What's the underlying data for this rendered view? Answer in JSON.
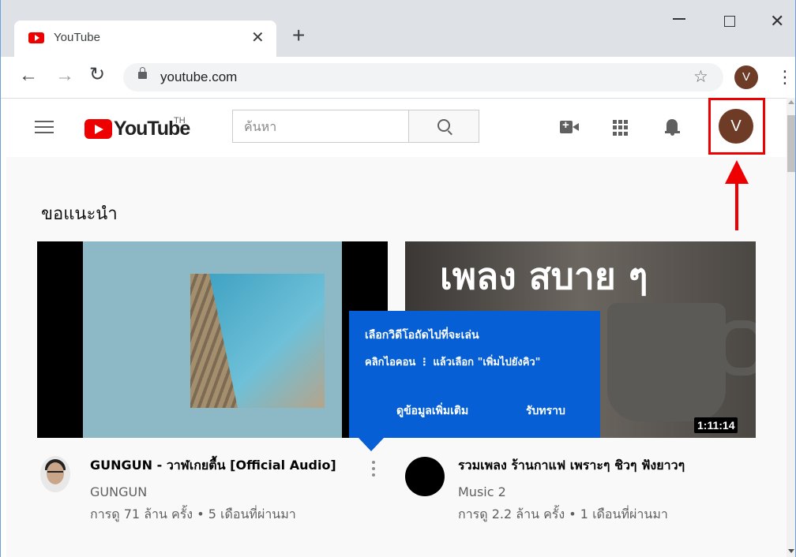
{
  "browser": {
    "tab_title": "YouTube",
    "tab_close": "✕",
    "new_tab": "+",
    "url": "youtube.com",
    "profile_initial": "V",
    "star": "☆",
    "kebab": "⋮",
    "back": "←",
    "forward": "→",
    "reload": "↻",
    "window_close": "✕"
  },
  "youtube": {
    "logo_text": "YouTube",
    "logo_region": "TH",
    "search_placeholder": "ค้นหา",
    "avatar_initial": "V",
    "section_title": "ขอแนะนำ"
  },
  "tooltip": {
    "title": "เลือกวิดีโอถัดไปที่จะเล่น",
    "body": "คลิกไอคอน ⋮ แล้วเลือก \"เพิ่มไปยังคิว\"",
    "more_button": "ดูข้อมูลเพิ่มเติม",
    "ok_button": "รับทราบ"
  },
  "videos": [
    {
      "title": "GUNGUN - วาฬเกยตื้น [Official Audio]",
      "channel": "GUNGUN",
      "meta": "การดู 71 ล้าน ครั้ง • 5 เดือนที่ผ่านมา"
    },
    {
      "title": "รวมเพลง ร้านกาแฟ เพราะๆ ชิวๆ ฟังยาวๆ",
      "channel": "Music 2",
      "meta": "การดู 2.2 ล้าน ครั้ง • 1 เดือนที่ผ่านมา",
      "thumb_text": "เพลง สบาย ๆ",
      "duration": "1:11:14"
    }
  ],
  "colors": {
    "youtube_red": "#ee0000",
    "tooltip_blue": "#065fd4",
    "highlight_red": "#ee0000"
  }
}
